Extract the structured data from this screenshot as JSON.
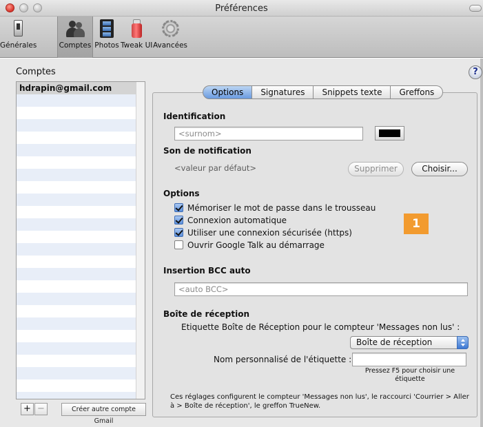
{
  "window": {
    "title": "Préférences"
  },
  "toolbar": {
    "items": [
      {
        "label": "Générales",
        "icon": "general-switch-icon"
      },
      {
        "label": "Comptes",
        "icon": "accounts-people-icon"
      },
      {
        "label": "Photos",
        "icon": "photos-film-icon"
      },
      {
        "label": "Tweak UI",
        "icon": "tweak-spraycan-icon"
      },
      {
        "label": "Avancées",
        "icon": "advanced-gear-icon"
      }
    ],
    "active": "Comptes"
  },
  "accounts": {
    "title": "Comptes",
    "items": [
      "hdrapin@gmail.com"
    ],
    "add_label": "+",
    "remove_label": "−",
    "create_button": "Créer autre compte Gmail"
  },
  "help": {
    "label": "?"
  },
  "tabs": [
    {
      "label": "Options",
      "active": true
    },
    {
      "label": "Signatures",
      "active": false
    },
    {
      "label": "Snippets texte",
      "active": false
    },
    {
      "label": "Greffons",
      "active": false
    }
  ],
  "identification": {
    "title": "Identification",
    "nickname_placeholder": "<surnom>",
    "color": "#000000"
  },
  "notification": {
    "title": "Son de notification",
    "value": "<valeur par défaut>",
    "delete_label": "Supprimer",
    "choose_label": "Choisir..."
  },
  "options": {
    "title": "Options",
    "items": [
      {
        "label": "Mémoriser le mot de passe dans le trousseau",
        "checked": true
      },
      {
        "label": "Connexion automatique",
        "checked": true
      },
      {
        "label": "Utiliser une connexion sécurisée (https)",
        "checked": true
      },
      {
        "label": "Ouvrir Google Talk au démarrage",
        "checked": false
      }
    ]
  },
  "callout": {
    "number": "1",
    "color": "#f29b2f"
  },
  "bcc": {
    "title": "Insertion BCC auto",
    "placeholder": "<auto BCC>"
  },
  "inbox": {
    "title": "Boîte de réception",
    "label_text": "Etiquette Boîte de Réception pour le compteur 'Messages non lus' :",
    "selected": "Boîte de réception",
    "custom_label": "Nom personnalisé de l'étiquette :",
    "custom_value": "",
    "hint": "Pressez F5 pour choisir une étiquette",
    "footer": "Ces réglages configurent le compteur 'Messages non lus', le raccourci 'Courrier > Aller à > Boîte de réception', le greffon TrueNew."
  }
}
